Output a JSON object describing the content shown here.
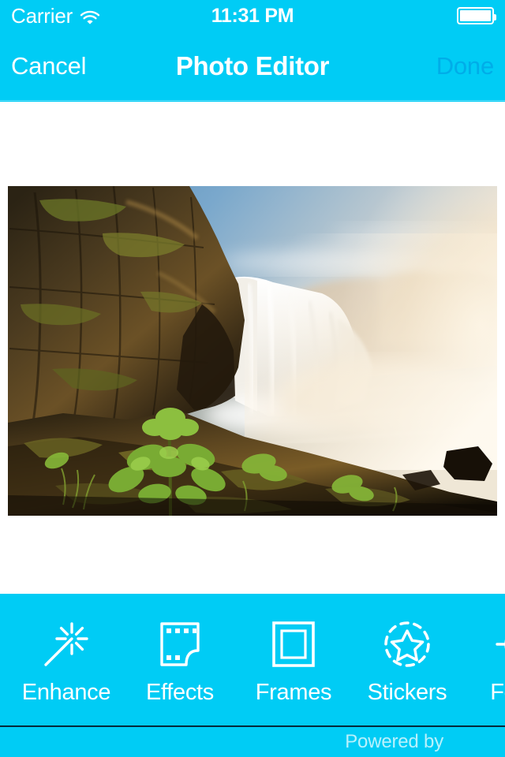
{
  "status_bar": {
    "carrier": "Carrier",
    "wifi_icon": "wifi-icon",
    "time": "11:31 PM",
    "battery_icon": "battery-full-icon"
  },
  "nav_bar": {
    "cancel_label": "Cancel",
    "title": "Photo Editor",
    "done_label": "Done",
    "done_state": "disabled"
  },
  "toolbar": {
    "items": [
      {
        "label": "Enhance",
        "icon": "magic-wand-icon"
      },
      {
        "label": "Effects",
        "icon": "film-frame-icon"
      },
      {
        "label": "Frames",
        "icon": "nested-squares-icon"
      },
      {
        "label": "Stickers",
        "icon": "dashed-circle-star-icon"
      },
      {
        "label": "Focus",
        "icon": "focus-circle-icon"
      }
    ]
  },
  "footer": {
    "powered_by": "Powered by"
  },
  "photo": {
    "alt": "Long-exposure waterfall beside a mossy basalt cliff at golden hour"
  },
  "colors": {
    "accent_cyan": "#00CCF5",
    "done_disabled": "#00ADE8",
    "canvas_bg": "#FFFFFF",
    "footer_rule": "#05293A",
    "icon_white": "#FFFFFF"
  }
}
